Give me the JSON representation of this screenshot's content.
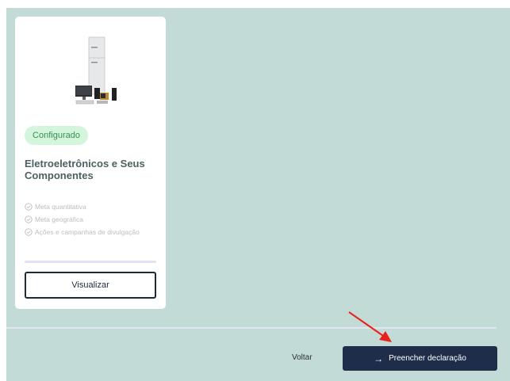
{
  "card": {
    "image_icon": "electronics-illustration",
    "status_badge": "Configurado",
    "title": "Eletroeletrônicos e Seus Componentes",
    "features": [
      {
        "icon": "check-circle-icon",
        "label": "Meta quantitativa"
      },
      {
        "icon": "check-circle-icon",
        "label": "Meta geográfica"
      },
      {
        "icon": "check-circle-icon",
        "label": "Ações e campanhas de divulgação"
      }
    ],
    "progress_fraction": 0,
    "view_button_label": "Visualizar"
  },
  "footer": {
    "back_label": "Voltar",
    "primary_icon": "arrow-right-icon",
    "primary_label": "Preencher declaração"
  },
  "colors": {
    "panel_background": "#c3dbd7",
    "badge_background": "#d3f5dc",
    "badge_text": "#3a8e56",
    "primary_button": "#1d2d4a",
    "annotation_arrow": "#e8221b"
  }
}
